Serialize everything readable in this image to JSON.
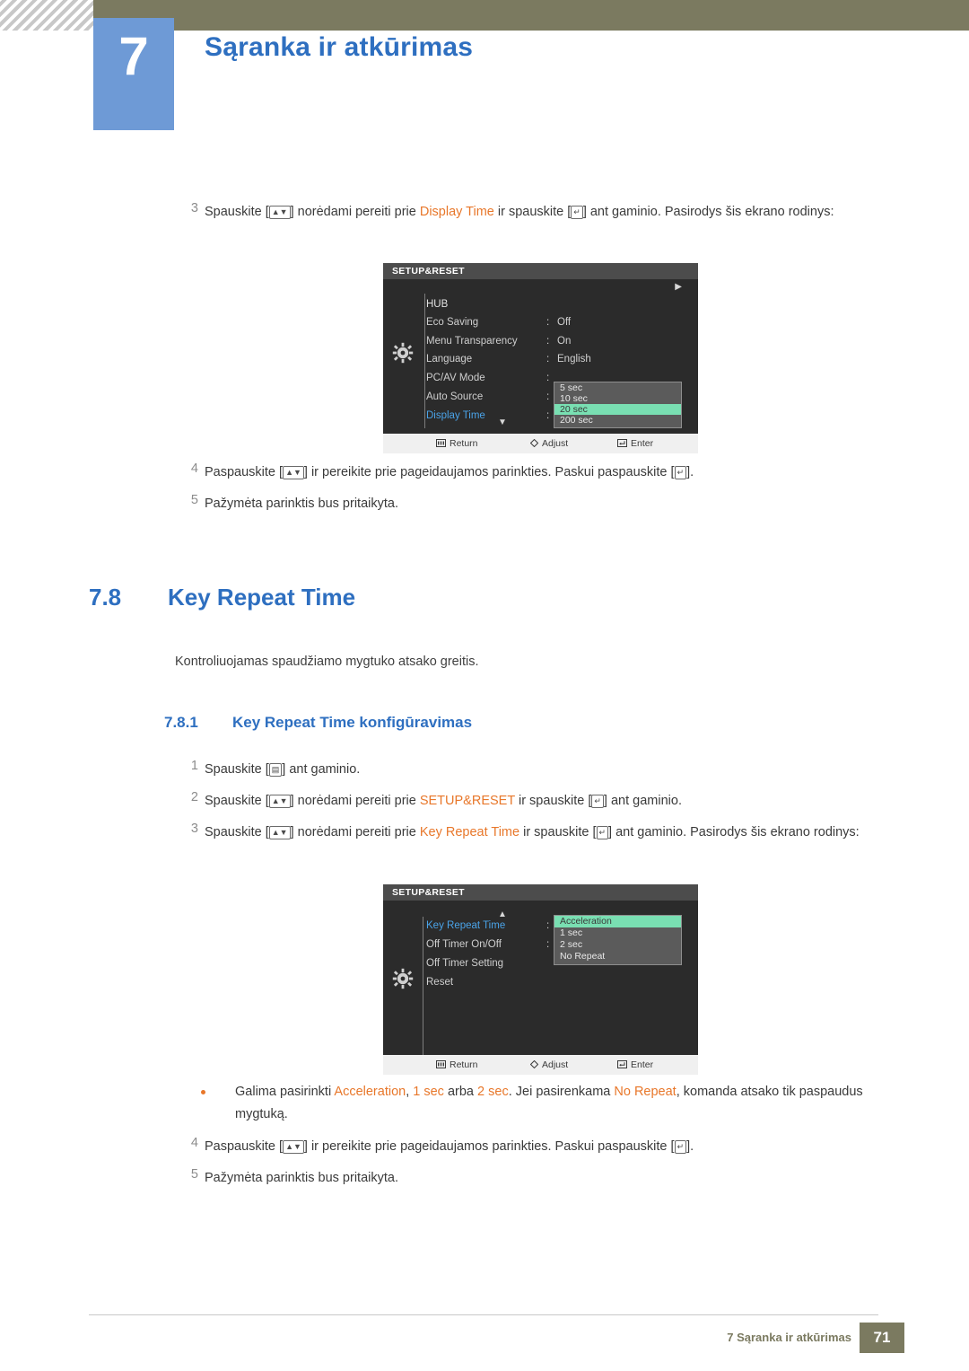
{
  "header": {
    "chapter_number": "7",
    "chapter_title": "Sąranka ir atkūrimas"
  },
  "steps_top": [
    {
      "num": "3",
      "text_parts": [
        {
          "t": "Spauskite [",
          "c": "normal"
        },
        {
          "t": "⌃⌄",
          "c": "key"
        },
        {
          "t": "] norėdami pereiti prie ",
          "c": "normal"
        },
        {
          "t": "Display Time",
          "c": "orange"
        },
        {
          "t": " ir spauskite [",
          "c": "normal"
        },
        {
          "t": "↵",
          "c": "key"
        },
        {
          "t": "] ant gaminio. Pasirodys šis ekrano rodinys:",
          "c": "normal"
        }
      ],
      "plain": "Spauskite [ ] norėdami pereiti prie Display Time ir spauskite [ ] ant gaminio. Pasirodys šis ekrano rodinys:"
    }
  ],
  "osd1": {
    "title": "SETUP&RESET",
    "header_item": "HUB",
    "items": [
      {
        "label": "Eco Saving",
        "value": "Off",
        "selected": false
      },
      {
        "label": "Menu Transparency",
        "value": "On",
        "selected": false
      },
      {
        "label": "Language",
        "value": "English",
        "selected": false
      },
      {
        "label": "PC/AV Mode",
        "value": "",
        "selected": false
      },
      {
        "label": "Auto Source",
        "value": "",
        "selected": false
      },
      {
        "label": "Display Time",
        "value": "",
        "selected": true
      }
    ],
    "dropdown": [
      {
        "label": "5 sec",
        "highlighted": false
      },
      {
        "label": "10 sec",
        "highlighted": false
      },
      {
        "label": "20 sec",
        "highlighted": true
      },
      {
        "label": "200 sec",
        "highlighted": false
      }
    ],
    "footer": {
      "return": "Return",
      "adjust": "Adjust",
      "enter": "Enter"
    }
  },
  "steps_mid": [
    {
      "num": "4",
      "pre": "Paspauskite [",
      "key1": "⌃⌄",
      "mid": "] ir pereikite prie pageidaujamos parinkties. Paskui paspauskite [",
      "key2": "↵",
      "post": "]."
    },
    {
      "num": "5",
      "pre": "Pažymėta parinktis bus pritaikyta.",
      "key1": "",
      "mid": "",
      "key2": "",
      "post": ""
    }
  ],
  "section": {
    "number": "7.8",
    "title": "Key Repeat Time",
    "description": "Kontroliuojamas spaudžiamo mygtuko atsako greitis.",
    "sub_number": "7.8.1",
    "sub_title": "Key Repeat Time konfigūravimas"
  },
  "steps_lower": [
    {
      "num": "1",
      "pre": "Spauskite [",
      "key1": "▤",
      "mid": "",
      "key2": "",
      "post": "] ant gaminio.",
      "orange": ""
    },
    {
      "num": "2",
      "pre": "Spauskite [",
      "key1": "⌃⌄",
      "mid": "] norėdami pereiti prie ",
      "orange": "SETUP&RESET",
      "mid2": " ir spauskite [",
      "key2": "↵",
      "post": "] ant gaminio."
    },
    {
      "num": "3",
      "pre": "Spauskite [",
      "key1": "⌃⌄",
      "mid": "] norėdami pereiti prie ",
      "orange": "Key Repeat Time",
      "mid2": " ir spauskite [",
      "key2": "↵",
      "post": "] ant gaminio. Pasirodys šis ekrano rodinys:",
      "line2": "ekrano rodinys:"
    }
  ],
  "osd2": {
    "title": "SETUP&RESET",
    "items": [
      {
        "label": "Key Repeat Time",
        "value": "",
        "selected": true
      },
      {
        "label": "Off Timer On/Off",
        "value": "",
        "selected": false
      },
      {
        "label": "Off Timer Setting",
        "value": "",
        "selected": false
      },
      {
        "label": "Reset",
        "value": "",
        "selected": false
      }
    ],
    "dropdown": [
      {
        "label": "Acceleration",
        "highlighted": true
      },
      {
        "label": "1 sec",
        "highlighted": false
      },
      {
        "label": "2 sec",
        "highlighted": false
      },
      {
        "label": "No Repeat",
        "highlighted": false
      }
    ],
    "footer": {
      "return": "Return",
      "adjust": "Adjust",
      "enter": "Enter"
    }
  },
  "note": {
    "parts": [
      {
        "t": "Galima pasirinkti ",
        "c": "normal"
      },
      {
        "t": "Acceleration",
        "c": "orange"
      },
      {
        "t": ", ",
        "c": "normal"
      },
      {
        "t": "1 sec",
        "c": "orange"
      },
      {
        "t": " arba ",
        "c": "normal"
      },
      {
        "t": "2 sec",
        "c": "orange"
      },
      {
        "t": ". Jei pasirenkama ",
        "c": "normal"
      },
      {
        "t": "No Repeat",
        "c": "orange"
      },
      {
        "t": ", komanda atsako tik paspaudus mygtuką.",
        "c": "normal"
      }
    ]
  },
  "steps_bottom": [
    {
      "num": "4",
      "pre": "Paspauskite [",
      "key1": "⌃⌄",
      "mid": "] ir pereikite prie pageidaujamos parinkties. Paskui paspauskite [",
      "key2": "↵",
      "post": "]."
    },
    {
      "num": "5",
      "pre": "Pažymėta parinktis bus pritaikyta.",
      "key1": "",
      "mid": "",
      "key2": "",
      "post": ""
    }
  ],
  "footer": {
    "text": "7 Sąranka ir atkūrimas",
    "page": "71"
  }
}
